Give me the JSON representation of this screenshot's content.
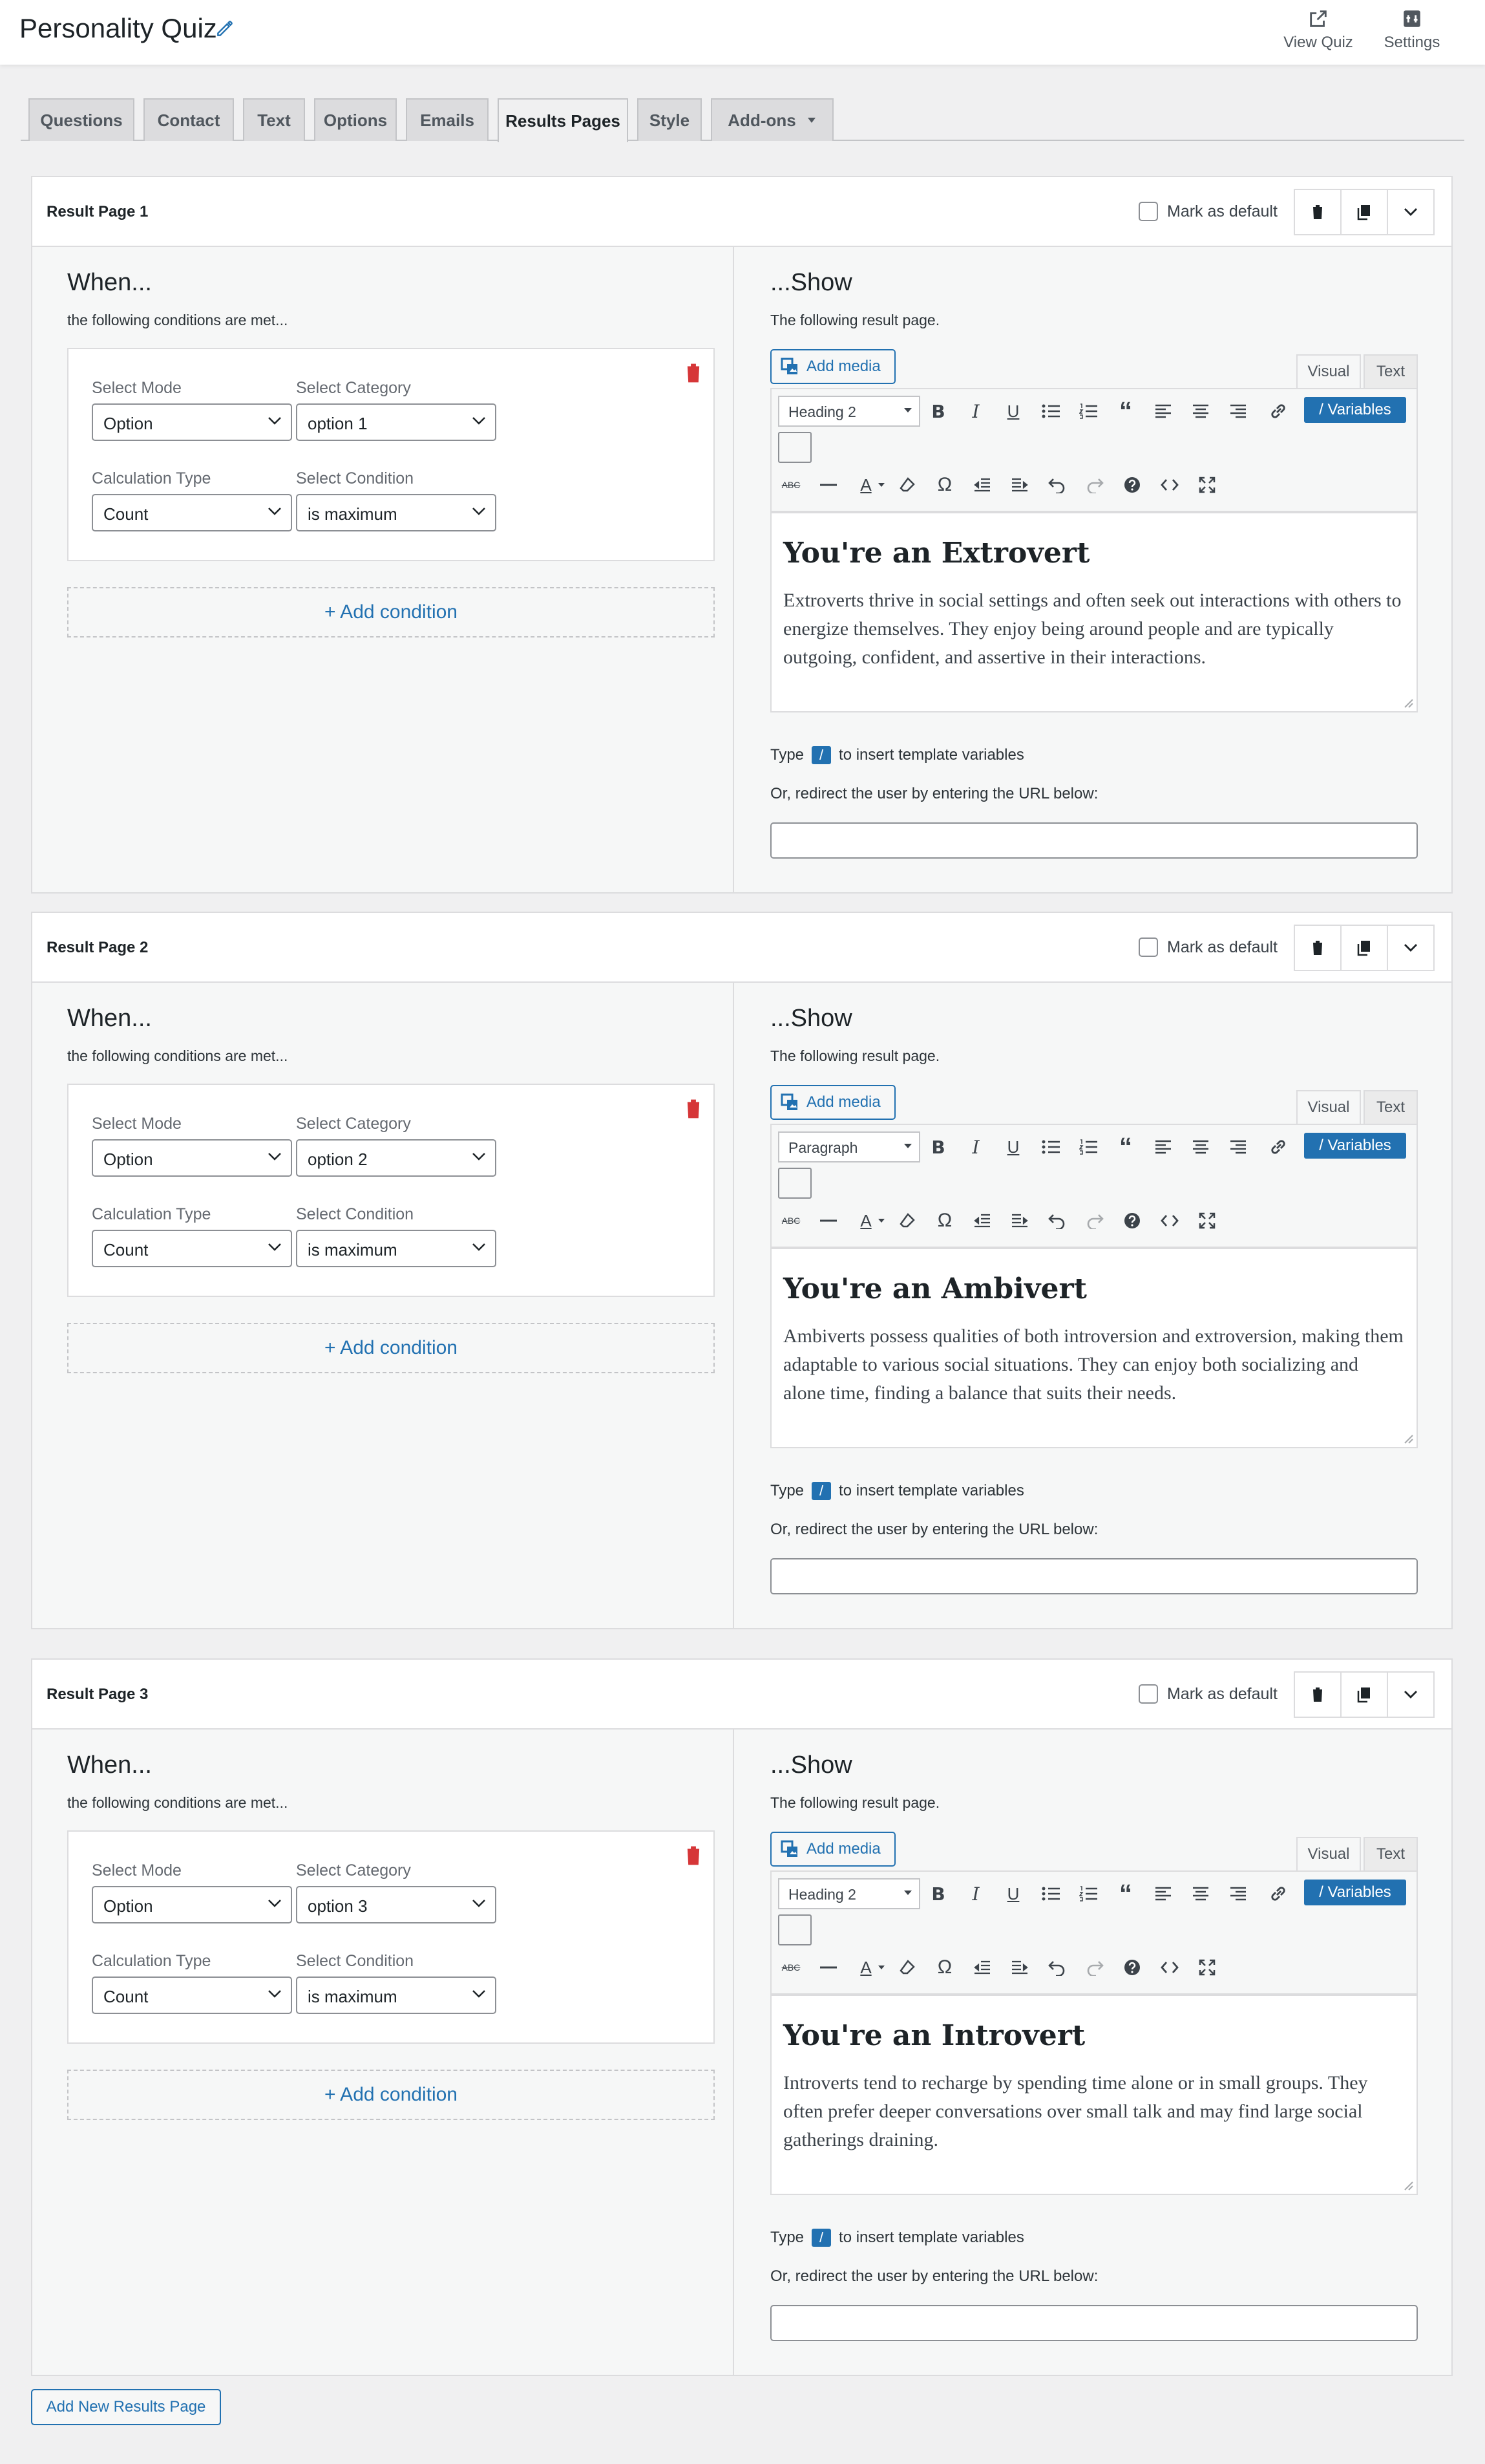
{
  "header": {
    "title": "Personality Quiz",
    "view_quiz": "View Quiz",
    "settings": "Settings"
  },
  "tabs": [
    "Questions",
    "Contact",
    "Text",
    "Options",
    "Emails",
    "Results Pages",
    "Style",
    "Add-ons"
  ],
  "active_tab": "Results Pages",
  "labels": {
    "mark_default": "Mark as default",
    "when": "When...",
    "when_sub": "the following conditions are met...",
    "select_mode": "Select Mode",
    "select_category": "Select Category",
    "calc_type": "Calculation Type",
    "select_condition": "Select Condition",
    "add_condition": "+ Add condition",
    "show": "...Show",
    "show_sub": "The following result page.",
    "add_media": "Add media",
    "visual": "Visual",
    "text": "Text",
    "variables": "/ Variables",
    "type_prefix": "Type",
    "slash": "/",
    "type_suffix": "to insert template variables",
    "redirect": "Or, redirect the user by entering the URL below:"
  },
  "results": [
    {
      "title": "Result Page 1",
      "mode": "Option",
      "category": "option 1",
      "calc": "Count",
      "condition": "is maximum",
      "format": "Heading 2",
      "heading": "You're an Extrovert",
      "body": "Extroverts thrive in social settings and often seek out interactions with others to energize themselves. They enjoy being around people and are typically outgoing, confident, and assertive in their interactions."
    },
    {
      "title": "Result Page 2",
      "mode": "Option",
      "category": "option 2",
      "calc": "Count",
      "condition": "is maximum",
      "format": "Paragraph",
      "heading": "You're an Ambivert",
      "body": "Ambiverts possess qualities of both introversion and extroversion, making them adaptable to various social situations. They can enjoy both socializing and alone time, finding a balance that suits their needs."
    },
    {
      "title": "Result Page 3",
      "mode": "Option",
      "category": "option 3",
      "calc": "Count",
      "condition": "is maximum",
      "format": "Heading 2",
      "heading": "You're an Introvert",
      "body": "Introverts tend to recharge by spending time alone or in small groups. They often prefer deeper conversations over small talk and may find large social gatherings draining."
    }
  ],
  "add_new": "Add New Results Page",
  "colors": {
    "accent": "#2271b1",
    "danger": "#d63638",
    "background": "#f0f0f1"
  }
}
